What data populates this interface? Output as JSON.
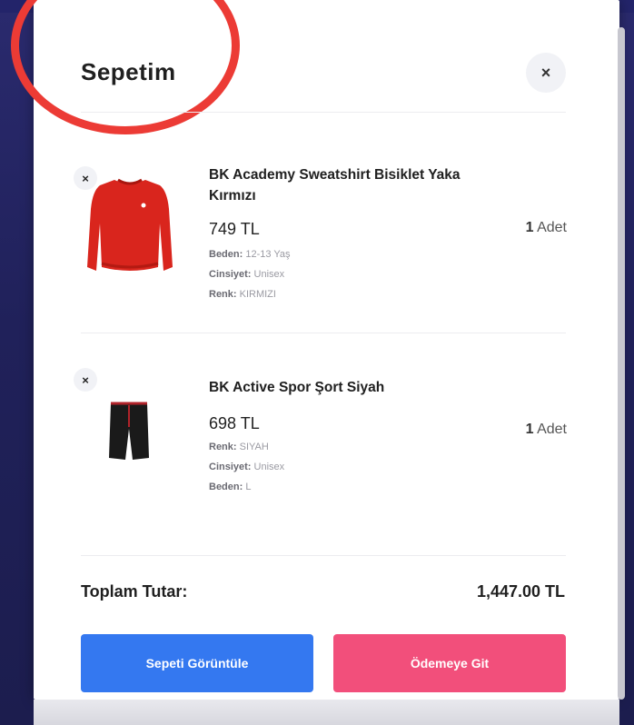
{
  "cart": {
    "title": "Sepetim",
    "close_label": "×",
    "items": [
      {
        "name": "BK Academy Sweatshirt Bisiklet Yaka Kırmızı",
        "price": "749 TL",
        "quantity": "1",
        "quantity_unit": "Adet",
        "attributes": [
          {
            "label": "Beden:",
            "value": "12-13 Yaş"
          },
          {
            "label": "Cinsiyet:",
            "value": "Unisex"
          },
          {
            "label": "Renk:",
            "value": "KIRMIZI"
          }
        ],
        "image_icon": "red-sweatshirt-image",
        "remove_label": "×"
      },
      {
        "name": "BK Active Spor Şort Siyah",
        "price": "698 TL",
        "quantity": "1",
        "quantity_unit": "Adet",
        "attributes": [
          {
            "label": "Renk:",
            "value": "SIYAH"
          },
          {
            "label": "Cinsiyet:",
            "value": "Unisex"
          },
          {
            "label": "Beden:",
            "value": "L"
          }
        ],
        "image_icon": "black-shorts-image",
        "remove_label": "×"
      }
    ],
    "total_label": "Toplam Tutar:",
    "total_value": "1,447.00 TL",
    "view_cart_label": "Sepeti Görüntüle",
    "checkout_label": "Ödemeye Git"
  },
  "colors": {
    "view_cart_button": "#3478f0",
    "checkout_button": "#f24f7b",
    "annotation_circle": "#ec3b35",
    "background": "#20215a"
  }
}
